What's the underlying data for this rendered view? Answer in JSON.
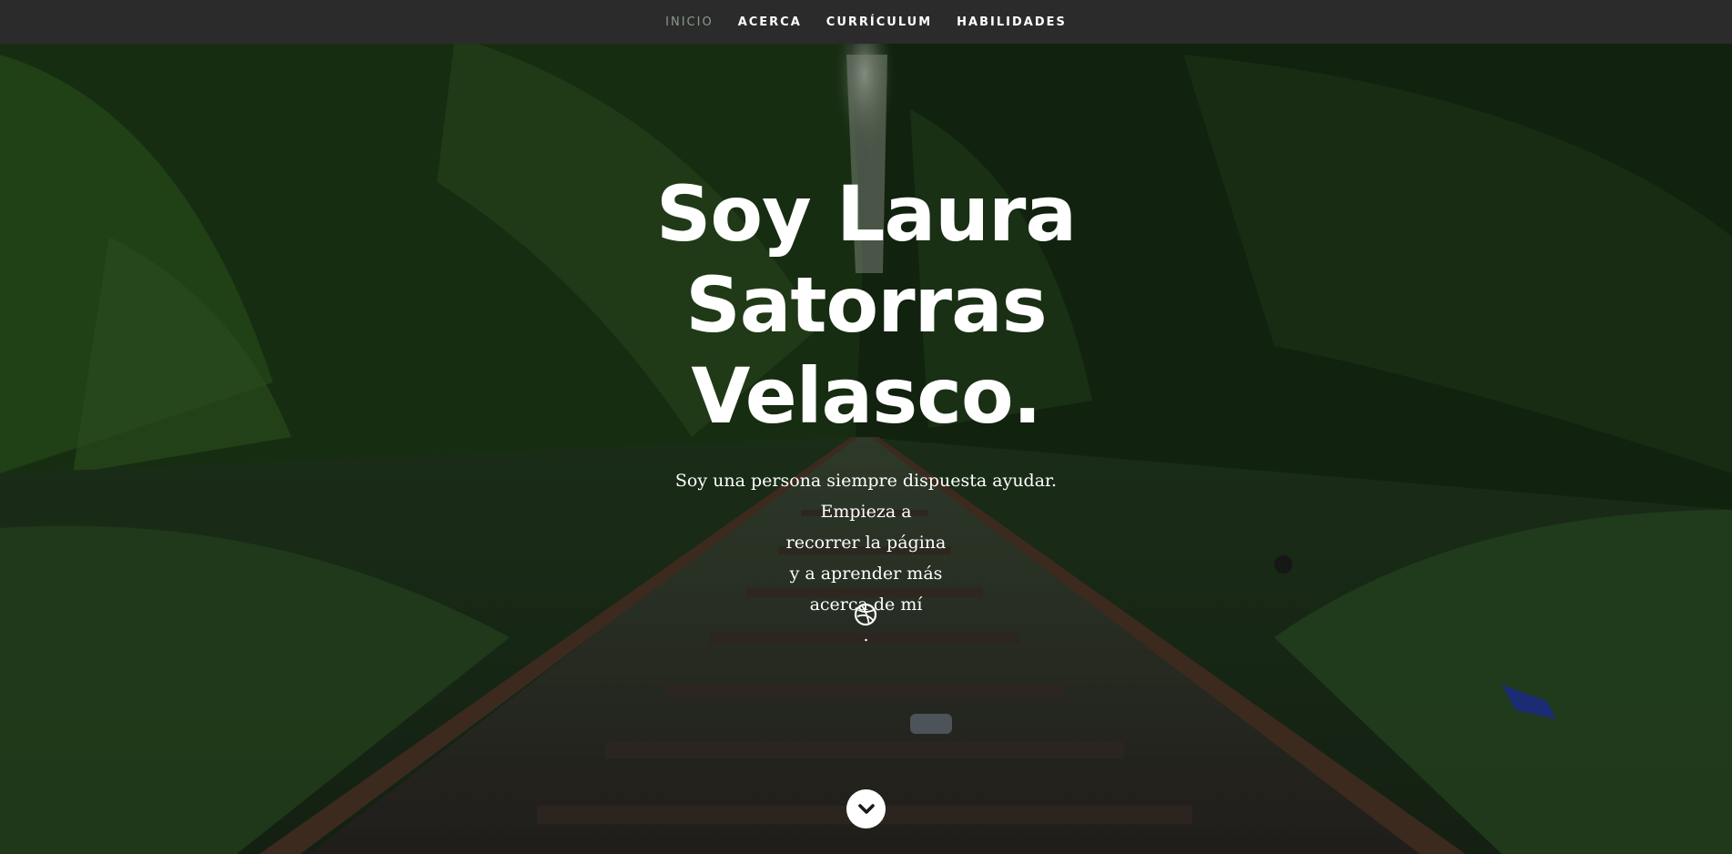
{
  "nav": {
    "items": [
      {
        "label": "INICIO",
        "active": true
      },
      {
        "label": "ACERCA",
        "active": false
      },
      {
        "label": "CURRÍCULUM",
        "active": false
      },
      {
        "label": "HABILIDADES",
        "active": false
      }
    ],
    "background": "#2b2b2b",
    "active_color": "#8b9a8b"
  },
  "hero": {
    "title_line1": "Soy Laura Satorras",
    "title_line2": "Velasco.",
    "intro_lines": [
      "Soy una persona siempre dispuesta ayudar.",
      "Empieza a",
      "recorrer la página",
      "y a aprender más",
      "acerca de mí",
      "."
    ]
  },
  "icons": {
    "social": "dribbble-icon",
    "scroll": "chevron-down-icon"
  },
  "colors": {
    "foliage": "#1f3a1a",
    "rail": "#5a3a2a"
  }
}
